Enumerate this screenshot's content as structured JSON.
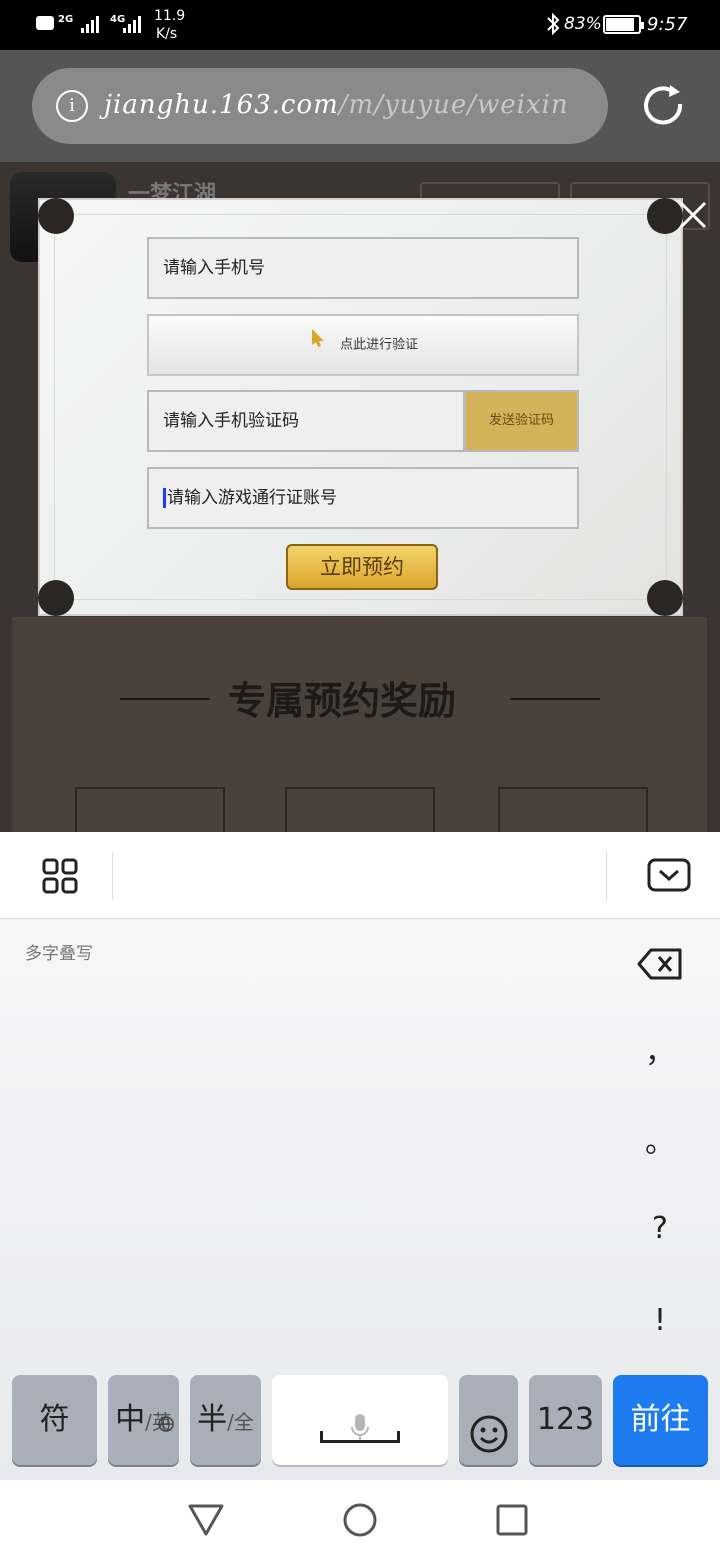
{
  "status_bar": {
    "net_speed_value": "11.9",
    "net_speed_unit": "K/s",
    "signal_1": "2G",
    "signal_2": "4G",
    "battery": "83%",
    "time": "9:57"
  },
  "browser": {
    "url_domain": "jianghu.163.com",
    "url_path": "/m/yuyue/weixin"
  },
  "page": {
    "app_title": "一梦江湖",
    "section_title": "专属预约奖励"
  },
  "modal": {
    "phone_placeholder": "请输入手机号",
    "verify_label": "点此进行验证",
    "code_placeholder": "请输入手机验证码",
    "send_code_label": "发送验证码",
    "account_placeholder": "请输入游戏通行证账号",
    "submit_label": "立即预约"
  },
  "keyboard": {
    "handwriting_hint": "多字叠写",
    "punctuation": [
      "，",
      "。",
      "?",
      "!"
    ],
    "keys": {
      "symbols": "符",
      "lang_main": "中",
      "lang_alt": "/英",
      "width_main": "半",
      "width_alt": "/全",
      "numbers": "123",
      "go": "前往"
    }
  },
  "colors": {
    "go_key": "#1e7cf0",
    "send_code_bg": "#d4b25a",
    "submit_bg": "#e8bd4a"
  }
}
